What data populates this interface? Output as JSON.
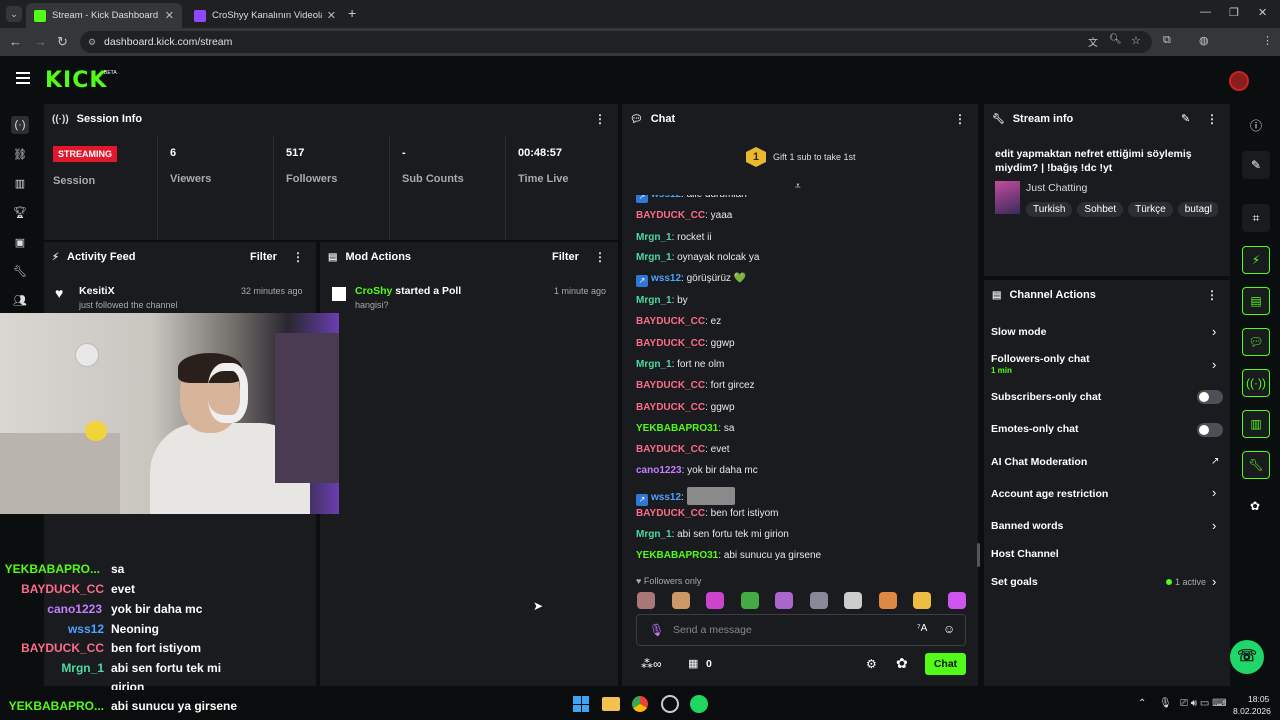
{
  "browser": {
    "tabs": [
      {
        "title": "Stream - Kick Dashboard",
        "active": true
      },
      {
        "title": "CroShyy Kanalının Videoları - Tw",
        "active": false
      }
    ],
    "url": "dashboard.kick.com/stream"
  },
  "kick": {
    "logo": "KICK",
    "beta": "BETA"
  },
  "session": {
    "title": "Session Info",
    "status": "STREAMING",
    "status_label": "Session",
    "stats": [
      {
        "value": "6",
        "label": "Viewers"
      },
      {
        "value": "517",
        "label": "Followers"
      },
      {
        "value": "-",
        "label": "Sub Counts"
      },
      {
        "value": "00:48:57",
        "label": "Time Live"
      }
    ]
  },
  "activity": {
    "title": "Activity Feed",
    "filter": "Filter",
    "items": [
      {
        "user": "KesitiX",
        "text": "just followed the channel",
        "time": "32 minutes ago"
      }
    ]
  },
  "mod": {
    "title": "Mod Actions",
    "filter": "Filter",
    "items": [
      {
        "user": "CroShy",
        "action": "started a Poll",
        "detail": "hangisi?",
        "time": "1 minute ago"
      }
    ]
  },
  "chat": {
    "title": "Chat",
    "gift_badge": "1",
    "gift_text": "Gift 1 sub to take 1st",
    "messages": [
      {
        "user": "wss12",
        "cls": "u-wss",
        "text": "aile durumları",
        "badge": true
      },
      {
        "user": "BAYDUCK_CC",
        "cls": "u-bay",
        "text": "yaaa"
      },
      {
        "user": "Mrgn_1",
        "cls": "u-mrg",
        "text": "rocket ii"
      },
      {
        "user": "Mrgn_1",
        "cls": "u-mrg",
        "text": "oynayak nolcak ya"
      },
      {
        "user": "wss12",
        "cls": "u-wss",
        "text": "görüşürüz 💚",
        "badge": true
      },
      {
        "user": "Mrgn_1",
        "cls": "u-mrg",
        "text": "by"
      },
      {
        "user": "BAYDUCK_CC",
        "cls": "u-bay",
        "text": "ez"
      },
      {
        "user": "BAYDUCK_CC",
        "cls": "u-bay",
        "text": "ggwp"
      },
      {
        "user": "Mrgn_1",
        "cls": "u-mrg",
        "text": "fort ne olm"
      },
      {
        "user": "BAYDUCK_CC",
        "cls": "u-bay",
        "text": "fort gircez"
      },
      {
        "user": "BAYDUCK_CC",
        "cls": "u-bay",
        "text": "ggwp"
      },
      {
        "user": "YEKBABAPRO31",
        "cls": "u-yek",
        "text": "sa"
      },
      {
        "user": "BAYDUCK_CC",
        "cls": "u-bay",
        "text": "evet"
      },
      {
        "user": "cano1223",
        "cls": "u-can",
        "text": "yok bir daha mc"
      },
      {
        "user": "wss12",
        "cls": "u-wss",
        "text": "",
        "badge": true,
        "emote": true
      },
      {
        "user": "BAYDUCK_CC",
        "cls": "u-bay",
        "text": "ben fort istiyom"
      },
      {
        "user": "Mrgn_1",
        "cls": "u-mrg",
        "text": "abi sen fortu tek mi girion"
      },
      {
        "user": "YEKBABAPRO31",
        "cls": "u-yek",
        "text": "abi sunucu ya girsene"
      }
    ],
    "followers_only": "Followers only",
    "placeholder": "Send a message",
    "count": "0",
    "send": "Chat"
  },
  "stream_info": {
    "title": "Stream info",
    "stream_title": "edit yapmaktan nefret ettiğimi söylemiş miydim? | !bağış !dc !yt",
    "category": "Just Chatting",
    "tags": [
      "Turkish",
      "Sohbet",
      "Türkçe",
      "butagl"
    ]
  },
  "channel_actions": {
    "title": "Channel Actions",
    "items": [
      {
        "label": "Slow mode",
        "type": "chevron"
      },
      {
        "label": "Followers-only chat",
        "sub": "1 min",
        "type": "chevron"
      },
      {
        "label": "Subscribers-only chat",
        "type": "toggle"
      },
      {
        "label": "Emotes-only chat",
        "type": "toggle"
      },
      {
        "label": "AI Chat Moderation",
        "type": "external"
      },
      {
        "label": "Account age restriction",
        "type": "chevron"
      },
      {
        "label": "Banned words",
        "type": "chevron"
      },
      {
        "label": "Host Channel",
        "type": "none"
      },
      {
        "label": "Set goals",
        "extra": "1 active",
        "type": "chevron"
      }
    ]
  },
  "overlay_chat": [
    {
      "user": "YEKBABAPRO...",
      "text": "sa",
      "color": "#53fc18"
    },
    {
      "user": "BAYDUCK_CC",
      "text": "evet",
      "color": "#ff6b8a"
    },
    {
      "user": "cano1223",
      "text": "yok bir daha mc",
      "color": "#c77dff"
    },
    {
      "user": "wss12",
      "text": "Neoning",
      "color": "#4da3ff"
    },
    {
      "user": "BAYDUCK_CC",
      "text": "ben fort istiyom",
      "color": "#ff6b8a"
    },
    {
      "user": "Mrgn_1",
      "text": "abi sen fortu tek mi",
      "color": "#4dd9a0"
    },
    {
      "user": "",
      "text": "girion",
      "color": "#fff"
    },
    {
      "user": "YEKBABAPRO...",
      "text": "abi sunucu ya girsene",
      "color": "#53fc18"
    }
  ],
  "taskbar": {
    "time": "18:05",
    "date": "8.02.2026"
  }
}
